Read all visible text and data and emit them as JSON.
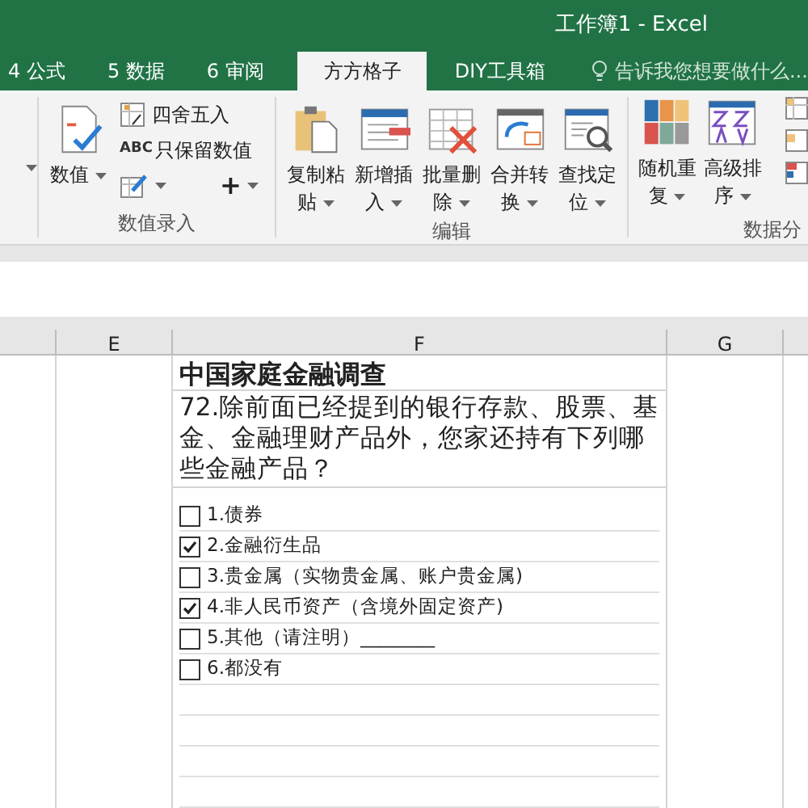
{
  "window": {
    "title": "工作簿1 - Excel"
  },
  "tabs": [
    {
      "label": "4 公式",
      "selected": false
    },
    {
      "label": "5 数据",
      "selected": false
    },
    {
      "label": "6 审阅",
      "selected": false
    },
    {
      "label": "方方格子",
      "selected": true
    },
    {
      "label": "DIY工具箱",
      "selected": false
    }
  ],
  "tell_me": {
    "placeholder": "告诉我您想要做什么..."
  },
  "ribbon": {
    "groups": [
      {
        "label": "数值录入",
        "big_buttons": [
          {
            "label": "数值"
          }
        ],
        "small_buttons": [
          {
            "kind": "text",
            "label": "四舍五入"
          },
          {
            "kind": "text",
            "icon_text": "ABC",
            "label": "只保留数值"
          },
          {
            "kind": "icon"
          },
          {
            "kind": "glyph",
            "label": "+"
          }
        ]
      },
      {
        "label": "编辑",
        "big_buttons": [
          {
            "label": "复制粘贴"
          },
          {
            "label": "新增插入"
          },
          {
            "label": "批量删除"
          },
          {
            "label": "合并转换"
          },
          {
            "label": "查找定位"
          }
        ]
      },
      {
        "label": "数据分",
        "big_buttons": [
          {
            "label": "随机重复"
          },
          {
            "label": "高级排序"
          }
        ]
      }
    ]
  },
  "columns": [
    {
      "label": "E"
    },
    {
      "label": "F"
    },
    {
      "label": "G"
    }
  ],
  "sheet": {
    "title": "中国家庭金融调查",
    "question": "72.除前面已经提到的银行存款、股票、基金、金融理财产品外，您家还持有下列哪些金融产品？",
    "options": [
      {
        "label": "1.债券",
        "checked": false
      },
      {
        "label": "2.金融衍生品",
        "checked": true
      },
      {
        "label": "3.贵金属（实物贵金属、账户贵金属)",
        "checked": false
      },
      {
        "label": "4.非人民币资产（含境外固定资产)",
        "checked": true
      },
      {
        "label": "5.其他（请注明）________",
        "checked": false
      },
      {
        "label": "6.都没有",
        "checked": false
      }
    ]
  }
}
